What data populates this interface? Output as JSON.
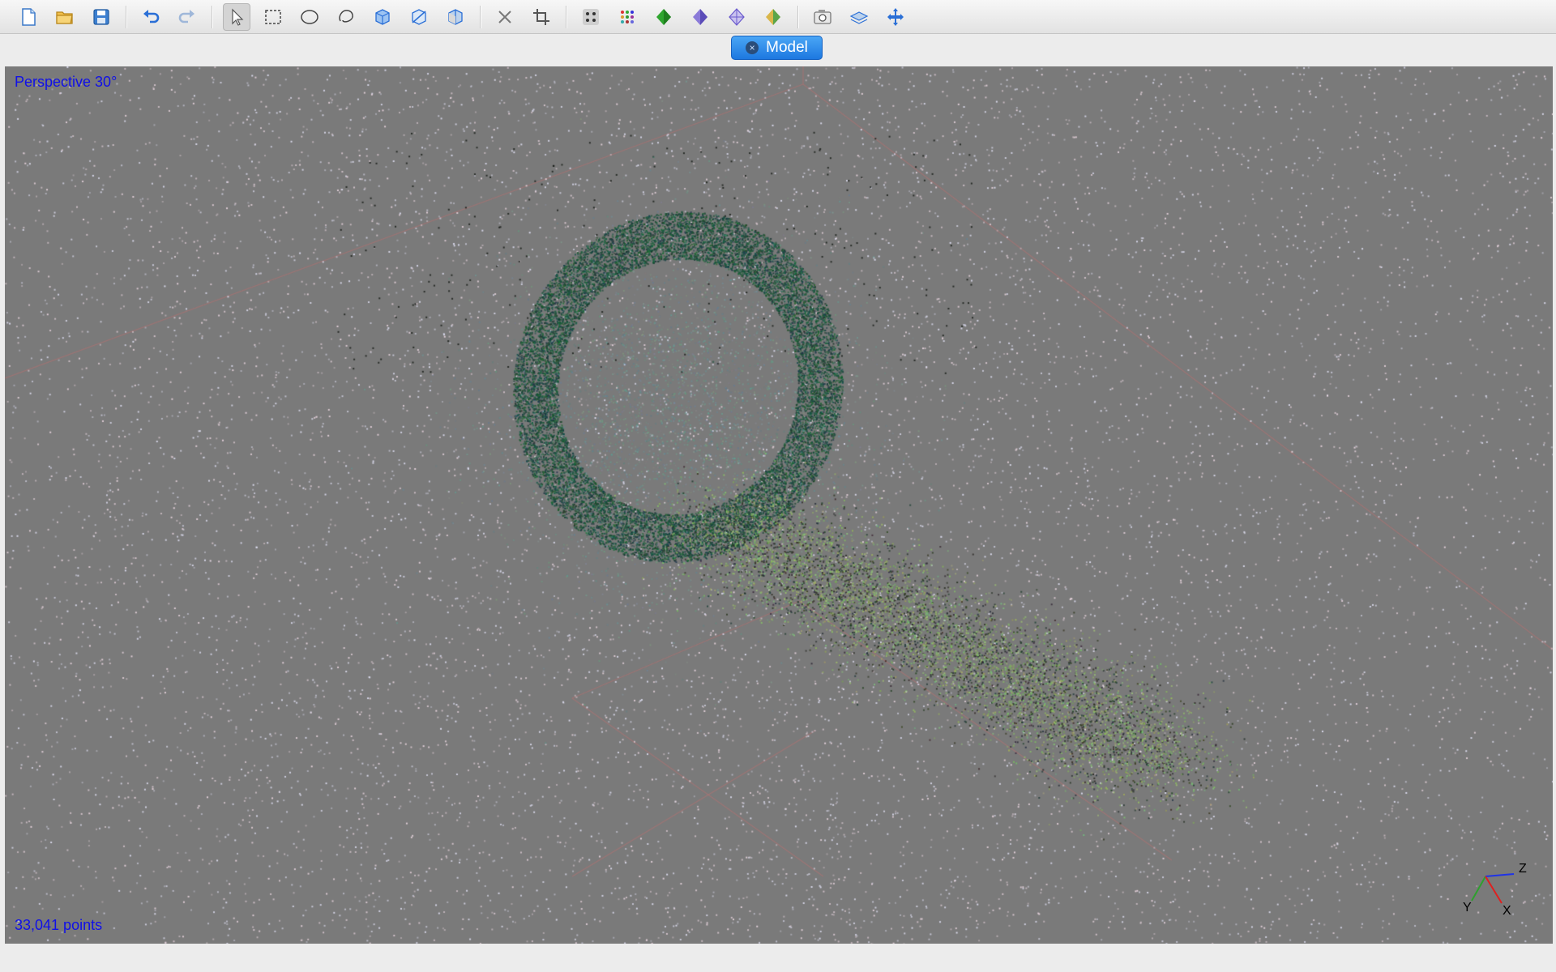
{
  "toolbar": {
    "items": [
      {
        "name": "new-file-icon"
      },
      {
        "name": "open-folder-icon"
      },
      {
        "name": "save-icon"
      },
      {
        "sep": true
      },
      {
        "name": "undo-icon"
      },
      {
        "name": "redo-icon"
      },
      {
        "sep": true
      },
      {
        "name": "pointer-select-icon",
        "active": true
      },
      {
        "name": "rectangle-select-icon"
      },
      {
        "name": "ellipse-select-icon"
      },
      {
        "name": "lasso-select-icon"
      },
      {
        "name": "select-all-icon"
      },
      {
        "name": "select-none-icon"
      },
      {
        "name": "invert-selection-icon"
      },
      {
        "sep": true
      },
      {
        "name": "delete-icon"
      },
      {
        "name": "crop-icon"
      },
      {
        "sep": true
      },
      {
        "name": "points-display-icon"
      },
      {
        "name": "colored-points-icon"
      },
      {
        "name": "shaded-model-icon"
      },
      {
        "name": "solid-model-icon"
      },
      {
        "name": "wireframe-model-icon"
      },
      {
        "name": "textured-model-icon"
      },
      {
        "sep": true
      },
      {
        "name": "cameras-icon"
      },
      {
        "name": "region-icon"
      },
      {
        "name": "navigate-icon"
      }
    ],
    "colors": {
      "accent_green": "#2fa52f",
      "accent_purple": "#6a5acd",
      "accent_blue": "#2a6fd6"
    }
  },
  "tab": {
    "label": "Model",
    "close": "×"
  },
  "viewport": {
    "projection_label": "Perspective 30°",
    "points_label": "33,041 points",
    "background": "#7a7a7a",
    "axes": {
      "x": "X",
      "y": "Y",
      "z": "Z"
    }
  }
}
